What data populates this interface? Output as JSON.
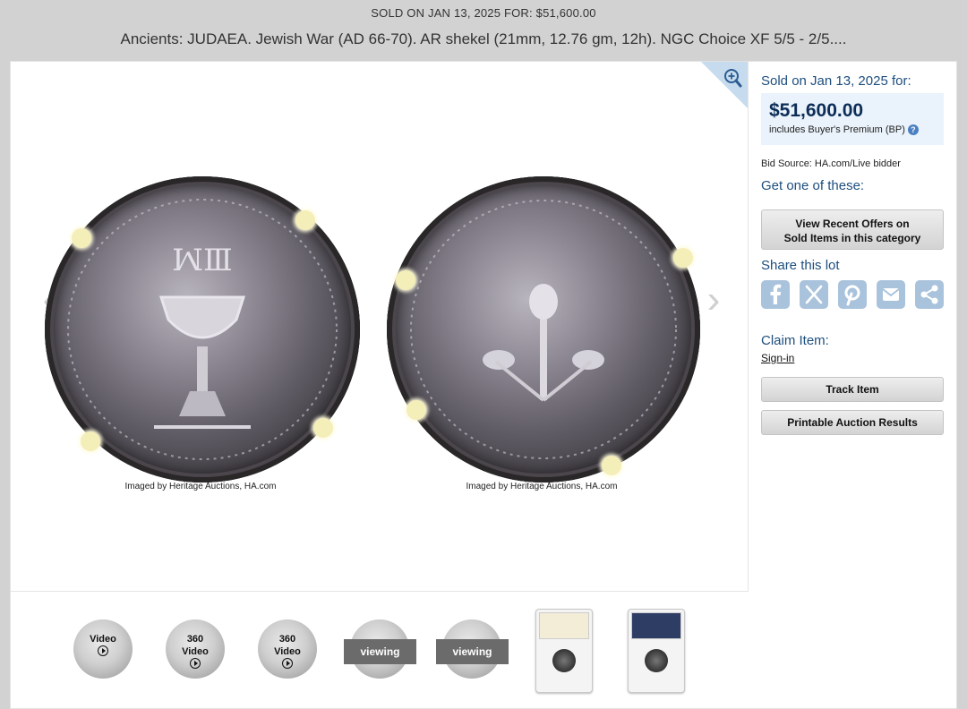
{
  "banner": {
    "sold_line": "SOLD ON JAN 13, 2025 FOR: $51,600.00",
    "title": "Ancients: JUDAEA. Jewish War (AD 66-70). AR shekel (21mm, 12.76 gm, 12h). NGC Choice XF 5/5 - 2/5...."
  },
  "viewer": {
    "caption_left": "Imaged by Heritage Auctions, HA.com",
    "caption_right": "Imaged by Heritage Auctions, HA.com",
    "zoom_icon": "zoom-in-icon",
    "prev_icon": "chevron-left-icon",
    "next_icon": "chevron-right-icon"
  },
  "thumbnails": [
    {
      "label": "Video",
      "kind": "video"
    },
    {
      "label": "360 Video",
      "kind": "video360"
    },
    {
      "label": "360 Video",
      "kind": "video360"
    },
    {
      "label": "viewing",
      "kind": "image"
    },
    {
      "label": "viewing",
      "kind": "image"
    },
    {
      "label": "",
      "kind": "slab"
    },
    {
      "label": "",
      "kind": "slab"
    }
  ],
  "thumb_text": {
    "video_1": "Video",
    "v360_a_line1": "360",
    "v360_a_line2": "Video",
    "v360_b_line1": "360",
    "v360_b_line2": "Video",
    "viewing_1": "viewing",
    "viewing_2": "viewing"
  },
  "sidebar": {
    "sold_on": "Sold on Jan 13, 2025 for:",
    "price": "$51,600.00",
    "bp_note": "includes Buyer's Premium (BP)",
    "help_glyph": "?",
    "bid_source": "Bid Source: HA.com/Live bidder",
    "get_one": "Get one of these:",
    "offers_line1": "View Recent Offers on",
    "offers_line2": "Sold Items in this category",
    "share_label": "Share this lot",
    "share_icons": [
      "facebook-icon",
      "x-icon",
      "pinterest-icon",
      "email-icon",
      "share-icon"
    ],
    "claim_label": "Claim Item:",
    "sign_in": "Sign-in",
    "track_item": "Track Item",
    "printable": "Printable Auction Results"
  },
  "colors": {
    "accent_blue": "#1d4e7e",
    "price_navy": "#0c2d57",
    "price_box": "#eaf3fb",
    "share_icon_bg": "#aac3dc"
  }
}
